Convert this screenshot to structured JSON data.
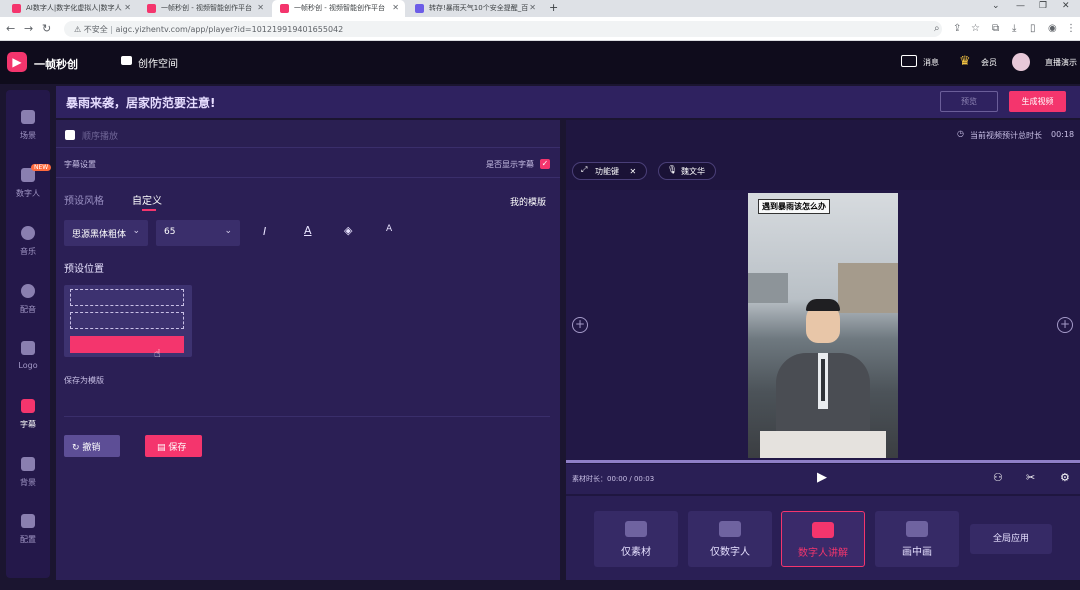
{
  "browser": {
    "tabs": [
      {
        "label": "AI数字人|数字化虚拟人|数字人"
      },
      {
        "label": "一帧秒创 - 视频智能创作平台"
      },
      {
        "label": "一帧秒创 - 视频智能创作平台"
      },
      {
        "label": "转存!暴雨天气10个安全提醒_百"
      }
    ],
    "active_tab": 2,
    "url_security": "不安全",
    "url": "aigc.yizhentv.com/app/player?id=1012199194016550​42"
  },
  "header": {
    "brand": "一帧秒创",
    "workspace": "创作空间",
    "messages": "消息",
    "member": "会员",
    "live": "直播演示"
  },
  "sidebar": {
    "items": [
      {
        "label": "场景",
        "icon": "scene-icon"
      },
      {
        "label": "数字人",
        "icon": "avatar-icon",
        "badge": "NEW"
      },
      {
        "label": "音乐",
        "icon": "music-icon"
      },
      {
        "label": "配音",
        "icon": "voice-icon"
      },
      {
        "label": "Logo",
        "icon": "logo-icon"
      },
      {
        "label": "字幕",
        "icon": "subtitle-icon",
        "active": true
      },
      {
        "label": "背景",
        "icon": "background-icon"
      },
      {
        "label": "配置",
        "icon": "config-icon"
      }
    ]
  },
  "title": {
    "text": "暴雨来袭，居家防范要注意!",
    "preview_label": "预览",
    "generate_label": "生成视频"
  },
  "editor": {
    "order_play": "顺序播放",
    "subtitle_settings": "字幕设置",
    "show_subtitle": "是否显示字幕",
    "tab_preset": "预设风格",
    "tab_custom": "自定义",
    "my_template": "我的模版",
    "font_value": "思源黑体粗体",
    "size_value": "65",
    "preset_position": "预设位置",
    "save_template": "保存为模版",
    "undo_label": "撤销",
    "save_label": "保存"
  },
  "player": {
    "duration_label": "当前视频预计总时长",
    "duration_value": "00:18",
    "chips": [
      "功能键",
      "魏文华"
    ],
    "caption": "遇到暴雨该怎么办",
    "material_label": "素材时长：00:00 / 00:03"
  },
  "modes": [
    {
      "label": "仅素材",
      "icon": "material-icon"
    },
    {
      "label": "仅数字人",
      "icon": "digital-human-icon"
    },
    {
      "label": "数字人讲解",
      "icon": "explain-icon",
      "active": true
    },
    {
      "label": "画中画",
      "icon": "pip-icon"
    }
  ],
  "global_apply": "全局应用",
  "colors": {
    "accent": "#f4356d",
    "panel": "#2b1f55",
    "header": "#0f0c1c"
  }
}
